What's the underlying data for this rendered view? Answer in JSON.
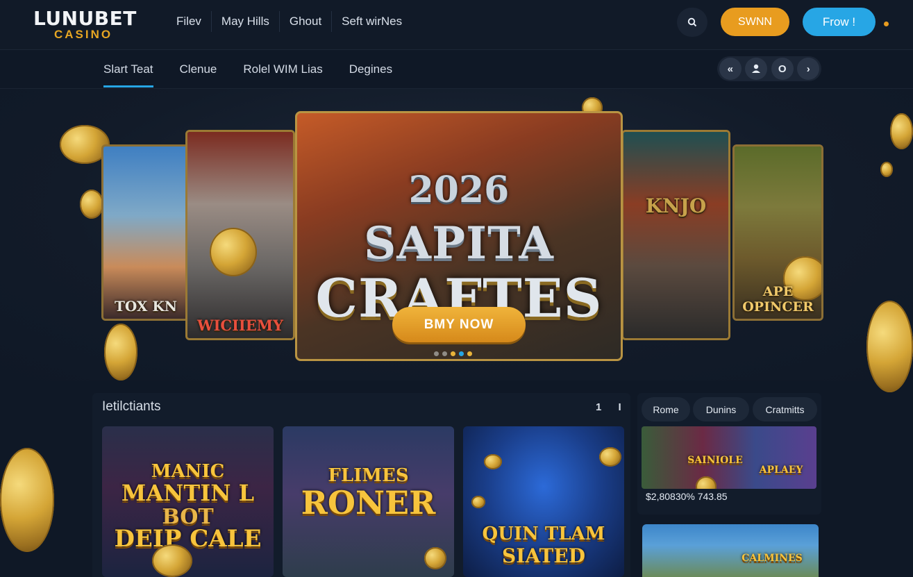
{
  "brand": {
    "name": "LUNUBET",
    "sub": "CASINO"
  },
  "top_nav": [
    "Filev",
    "May Hills",
    "Ghout",
    "Seft wirNes"
  ],
  "header_buttons": {
    "signin": "SWNN",
    "join": "Frow !"
  },
  "sub_tabs": [
    "Slart Teat",
    "Clenue",
    "Rolel WIM Lias",
    "Degines"
  ],
  "sub_icons": [
    "back-icon",
    "user-icon",
    "circle-icon",
    "forward-icon"
  ],
  "hero": {
    "side_cards": [
      "TOX KN",
      "WICIIEMY",
      "KNJO",
      "APE OPINCER"
    ],
    "main": {
      "year": "2026",
      "title_line1": "SAPITA",
      "title_line2": "CRAFTES",
      "cta": "BMY NOW"
    }
  },
  "section": {
    "title": "Ietilctiants",
    "pager": "1 I",
    "tiles": [
      {
        "lines": [
          "MANIC",
          "MANTIN L",
          "BOT",
          "DEIP CALE"
        ]
      },
      {
        "lines": [
          "FLIMES",
          "RONER"
        ]
      },
      {
        "lines": [
          "QUIN TLAM",
          "SIATED"
        ]
      }
    ]
  },
  "side_panel": {
    "pills": [
      "Rome",
      "Dunins",
      "Cratmitts"
    ],
    "banner_labels": [
      "SAINIOLE",
      "APLAEY"
    ],
    "winners": "$2,80830% 743.85",
    "promo_label": "CALMINES"
  },
  "colors": {
    "accent_blue": "#27a6e5",
    "accent_gold": "#e89c1f",
    "bg": "#0f1826"
  }
}
